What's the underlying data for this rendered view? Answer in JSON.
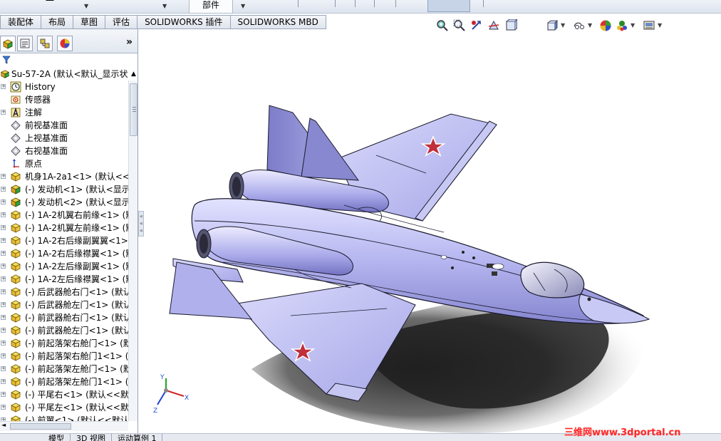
{
  "window": {
    "part_button_label": "部件",
    "top_fragment": "一"
  },
  "command_tabs": [
    {
      "label": "装配体",
      "active": true
    },
    {
      "label": "布局",
      "active": false
    },
    {
      "label": "草图",
      "active": false
    },
    {
      "label": "评估",
      "active": false
    },
    {
      "label": "SOLIDWORKS 插件",
      "active": false
    },
    {
      "label": "SOLIDWORKS MBD",
      "active": false
    }
  ],
  "view_toolbar": {
    "icons": [
      "zoom-to-fit-icon",
      "zoom-to-area-icon",
      "previous-view-icon",
      "section-view-icon",
      "dynamic-annotation-icon",
      "view-orientation-icon",
      "display-style-icon",
      "hide-show-items-icon",
      "edit-appearance-icon",
      "apply-scene-icon",
      "view-settings-icon"
    ]
  },
  "panel": {
    "tabs": [
      "featuremanager-icon",
      "propertymanager-icon",
      "configurationmanager-icon",
      "displaymanager-icon"
    ],
    "expand_label": "»",
    "root_label": "Su-57-2A  (默认<默认_显示状",
    "items": [
      {
        "label": "History",
        "icon": "history-icon",
        "expandable": true
      },
      {
        "label": "传感器",
        "icon": "sensor-icon",
        "expandable": false
      },
      {
        "label": "注解",
        "icon": "annotation-icon",
        "expandable": true
      },
      {
        "label": "前视基准面",
        "icon": "plane-icon",
        "expandable": false
      },
      {
        "label": "上视基准面",
        "icon": "plane-icon",
        "expandable": false
      },
      {
        "label": "右视基准面",
        "icon": "plane-icon",
        "expandable": false
      },
      {
        "label": "原点",
        "icon": "origin-icon",
        "expandable": false
      },
      {
        "label": "机身1A-2a1<1> (默认<<默",
        "icon": "part-icon",
        "expandable": true
      },
      {
        "label": "(-) 发动机<1> (默认<显示",
        "icon": "assembly-icon",
        "expandable": true
      },
      {
        "label": "(-) 发动机<2> (默认<显示",
        "icon": "assembly-icon",
        "expandable": true
      },
      {
        "label": "(-) 1A-2机翼右前缘<1> (默",
        "icon": "part-icon",
        "expandable": true
      },
      {
        "label": "(-) 1A-2机翼左前缘<1> (默",
        "icon": "part-icon",
        "expandable": true
      },
      {
        "label": "(-) 1A-2右后缘副翼翼<1>",
        "icon": "part-icon",
        "expandable": true
      },
      {
        "label": "(-) 1A-2右后缘襟翼<1> (默",
        "icon": "part-icon",
        "expandable": true
      },
      {
        "label": "(-) 1A-2左后缘副翼<1> (默",
        "icon": "part-icon",
        "expandable": true
      },
      {
        "label": "(-) 1A-2左后缘襟翼<1> (默",
        "icon": "part-icon",
        "expandable": true
      },
      {
        "label": "(-) 后武器舱右门<1> (默认",
        "icon": "part-icon",
        "expandable": true
      },
      {
        "label": "(-) 后武器舱左门<1> (默认",
        "icon": "part-icon",
        "expandable": true
      },
      {
        "label": "(-) 前武器舱右门<1> (默认",
        "icon": "part-icon",
        "expandable": true
      },
      {
        "label": "(-) 前武器舱左门<1> (默认",
        "icon": "part-icon",
        "expandable": true
      },
      {
        "label": "(-) 前起落架右舱门<1> (默",
        "icon": "part-icon",
        "expandable": true
      },
      {
        "label": "(-) 前起落架右舱门1<1> (默",
        "icon": "part-icon",
        "expandable": true
      },
      {
        "label": "(-) 前起落架左舱门<1> (默",
        "icon": "part-icon",
        "expandable": true
      },
      {
        "label": "(-) 前起落架左舱门1<1> (默",
        "icon": "part-icon",
        "expandable": true
      },
      {
        "label": "(-) 平尾右<1> (默认<<默认",
        "icon": "part-icon",
        "expandable": true
      },
      {
        "label": "(-) 平尾左<1> (默认<<默认",
        "icon": "part-icon",
        "expandable": true
      },
      {
        "label": "(-) 前翼<1> (默认<<默认",
        "icon": "part-icon",
        "expandable": true
      }
    ]
  },
  "bottom_tabs": [
    {
      "label": "模型",
      "active": true
    },
    {
      "label": "3D 视图",
      "active": false
    },
    {
      "label": "运动算例 1",
      "active": false
    }
  ],
  "triad": {
    "x": "X",
    "y": "Y",
    "z": "Z"
  },
  "watermark": "三维网www.3dportal.cn",
  "colors": {
    "aircraft_body": "#b8b8f0",
    "aircraft_shade": "#7d7dc8",
    "aircraft_edge": "#1a1a2e",
    "star_red": "#c0303a",
    "shadow": "#2a2a2a",
    "watermark": "#ff2a2a"
  }
}
